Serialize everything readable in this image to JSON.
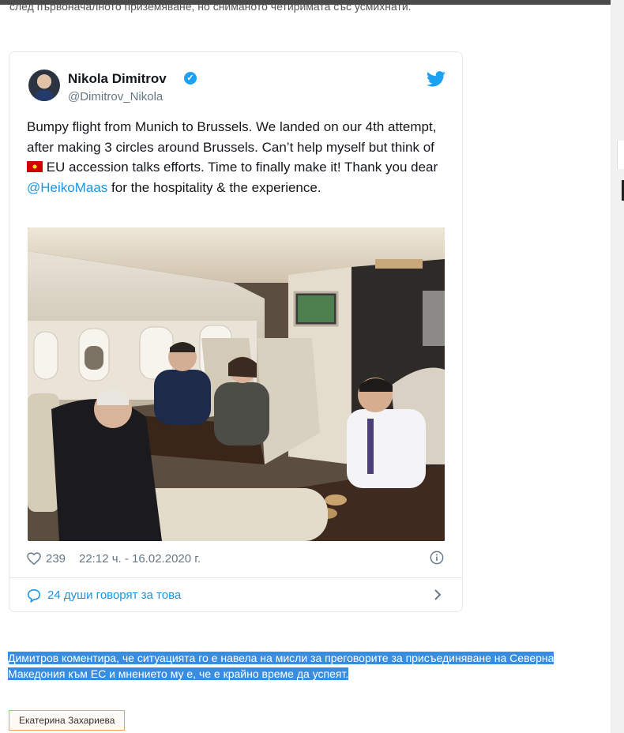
{
  "article": {
    "top_text": "след първоначалното приземяване, но сниманото четиримата със усмихнати.",
    "highlighted_paragraph": "Димитров коментира, че ситуацията го е навела на мисли за преговорите за присъединяване на Северна Македония към ЕС и мнението му е, че е крайно време да успеят.",
    "author_tag": "Екатерина Захариева"
  },
  "tweet": {
    "author_name": "Nikola Dimitrov",
    "handle": "@Dimitrov_Nikola",
    "verified_icon": "verified-badge-icon",
    "text_part1": "Bumpy flight from Munich to Brussels. We landed on our 4th attempt, after making 3 circles around Brussels. Can’t help myself but think of ",
    "flag_icon": "north-macedonia-flag-icon",
    "text_part2": " EU accession talks efforts. Time to finally make it! Thank you dear ",
    "mention": "@HeikoMaas",
    "text_part3": " for the hospitality & the experience.",
    "likes": "239",
    "timestamp": "22:12 ч. - 16.02.2020 г.",
    "discussion_label": "24 души говорят за това"
  },
  "colors": {
    "twitter_blue": "#1da1f2",
    "link_blue": "#1b95e0",
    "highlight_bg": "#3a8dde",
    "muted_text": "#657786"
  }
}
